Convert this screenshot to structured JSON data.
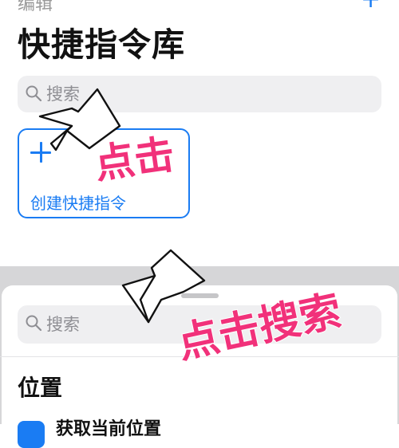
{
  "nav": {
    "edit_label": "编辑",
    "add_label": "+"
  },
  "page": {
    "title": "快捷指令库"
  },
  "search_top": {
    "placeholder": "搜索"
  },
  "create_tile": {
    "label": "创建快捷指令"
  },
  "sheet": {
    "search_placeholder": "搜索",
    "section_title": "位置",
    "items": [
      {
        "label": "获取当前位置",
        "icon": "location-icon"
      }
    ]
  },
  "annotations": {
    "click_label": "点击",
    "click_search_label": "点击搜索",
    "color": "#f1317a"
  },
  "colors": {
    "accent": "#1a7cf3",
    "search_bg": "#efeff1",
    "dim_bg": "#d6d6d8"
  }
}
